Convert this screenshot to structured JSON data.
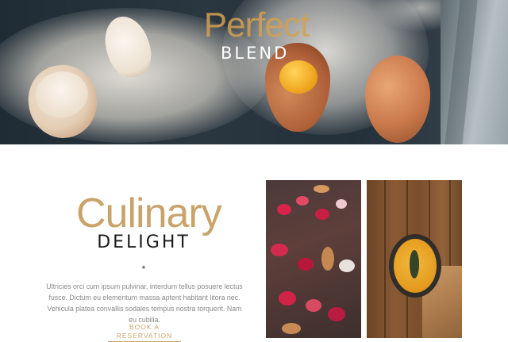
{
  "hero": {
    "script_title": "Perfect",
    "sub_title": "BLEND"
  },
  "intro": {
    "script_title": "Culinary",
    "sub_title": "DELIGHT",
    "divider": "*",
    "description": "Ultricies orci cum ipsum pulvinar, interdum tellus posuere lectus fusce. Dictum eu elementum massa aptent habitant litora nec. Vehicula platea convallis sodales tempus nostra torquent. Nam eu cubilia.",
    "cta_label": "BOOK A RESERVATION"
  },
  "colors": {
    "accent": "#c9a46a",
    "body_text": "#8a8a8a",
    "heading_dark": "#1a1a1a"
  }
}
